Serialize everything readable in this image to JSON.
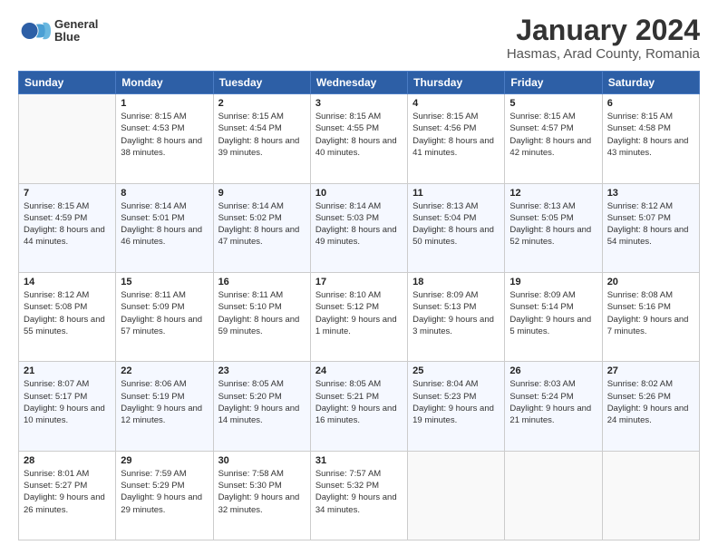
{
  "logo": {
    "line1": "General",
    "line2": "Blue"
  },
  "title": "January 2024",
  "subtitle": "Hasmas, Arad County, Romania",
  "days_of_week": [
    "Sunday",
    "Monday",
    "Tuesday",
    "Wednesday",
    "Thursday",
    "Friday",
    "Saturday"
  ],
  "weeks": [
    [
      {
        "day": "",
        "sunrise": "",
        "sunset": "",
        "daylight": ""
      },
      {
        "day": "1",
        "sunrise": "Sunrise: 8:15 AM",
        "sunset": "Sunset: 4:53 PM",
        "daylight": "Daylight: 8 hours and 38 minutes."
      },
      {
        "day": "2",
        "sunrise": "Sunrise: 8:15 AM",
        "sunset": "Sunset: 4:54 PM",
        "daylight": "Daylight: 8 hours and 39 minutes."
      },
      {
        "day": "3",
        "sunrise": "Sunrise: 8:15 AM",
        "sunset": "Sunset: 4:55 PM",
        "daylight": "Daylight: 8 hours and 40 minutes."
      },
      {
        "day": "4",
        "sunrise": "Sunrise: 8:15 AM",
        "sunset": "Sunset: 4:56 PM",
        "daylight": "Daylight: 8 hours and 41 minutes."
      },
      {
        "day": "5",
        "sunrise": "Sunrise: 8:15 AM",
        "sunset": "Sunset: 4:57 PM",
        "daylight": "Daylight: 8 hours and 42 minutes."
      },
      {
        "day": "6",
        "sunrise": "Sunrise: 8:15 AM",
        "sunset": "Sunset: 4:58 PM",
        "daylight": "Daylight: 8 hours and 43 minutes."
      }
    ],
    [
      {
        "day": "7",
        "sunrise": "Sunrise: 8:15 AM",
        "sunset": "Sunset: 4:59 PM",
        "daylight": "Daylight: 8 hours and 44 minutes."
      },
      {
        "day": "8",
        "sunrise": "Sunrise: 8:14 AM",
        "sunset": "Sunset: 5:01 PM",
        "daylight": "Daylight: 8 hours and 46 minutes."
      },
      {
        "day": "9",
        "sunrise": "Sunrise: 8:14 AM",
        "sunset": "Sunset: 5:02 PM",
        "daylight": "Daylight: 8 hours and 47 minutes."
      },
      {
        "day": "10",
        "sunrise": "Sunrise: 8:14 AM",
        "sunset": "Sunset: 5:03 PM",
        "daylight": "Daylight: 8 hours and 49 minutes."
      },
      {
        "day": "11",
        "sunrise": "Sunrise: 8:13 AM",
        "sunset": "Sunset: 5:04 PM",
        "daylight": "Daylight: 8 hours and 50 minutes."
      },
      {
        "day": "12",
        "sunrise": "Sunrise: 8:13 AM",
        "sunset": "Sunset: 5:05 PM",
        "daylight": "Daylight: 8 hours and 52 minutes."
      },
      {
        "day": "13",
        "sunrise": "Sunrise: 8:12 AM",
        "sunset": "Sunset: 5:07 PM",
        "daylight": "Daylight: 8 hours and 54 minutes."
      }
    ],
    [
      {
        "day": "14",
        "sunrise": "Sunrise: 8:12 AM",
        "sunset": "Sunset: 5:08 PM",
        "daylight": "Daylight: 8 hours and 55 minutes."
      },
      {
        "day": "15",
        "sunrise": "Sunrise: 8:11 AM",
        "sunset": "Sunset: 5:09 PM",
        "daylight": "Daylight: 8 hours and 57 minutes."
      },
      {
        "day": "16",
        "sunrise": "Sunrise: 8:11 AM",
        "sunset": "Sunset: 5:10 PM",
        "daylight": "Daylight: 8 hours and 59 minutes."
      },
      {
        "day": "17",
        "sunrise": "Sunrise: 8:10 AM",
        "sunset": "Sunset: 5:12 PM",
        "daylight": "Daylight: 9 hours and 1 minute."
      },
      {
        "day": "18",
        "sunrise": "Sunrise: 8:09 AM",
        "sunset": "Sunset: 5:13 PM",
        "daylight": "Daylight: 9 hours and 3 minutes."
      },
      {
        "day": "19",
        "sunrise": "Sunrise: 8:09 AM",
        "sunset": "Sunset: 5:14 PM",
        "daylight": "Daylight: 9 hours and 5 minutes."
      },
      {
        "day": "20",
        "sunrise": "Sunrise: 8:08 AM",
        "sunset": "Sunset: 5:16 PM",
        "daylight": "Daylight: 9 hours and 7 minutes."
      }
    ],
    [
      {
        "day": "21",
        "sunrise": "Sunrise: 8:07 AM",
        "sunset": "Sunset: 5:17 PM",
        "daylight": "Daylight: 9 hours and 10 minutes."
      },
      {
        "day": "22",
        "sunrise": "Sunrise: 8:06 AM",
        "sunset": "Sunset: 5:19 PM",
        "daylight": "Daylight: 9 hours and 12 minutes."
      },
      {
        "day": "23",
        "sunrise": "Sunrise: 8:05 AM",
        "sunset": "Sunset: 5:20 PM",
        "daylight": "Daylight: 9 hours and 14 minutes."
      },
      {
        "day": "24",
        "sunrise": "Sunrise: 8:05 AM",
        "sunset": "Sunset: 5:21 PM",
        "daylight": "Daylight: 9 hours and 16 minutes."
      },
      {
        "day": "25",
        "sunrise": "Sunrise: 8:04 AM",
        "sunset": "Sunset: 5:23 PM",
        "daylight": "Daylight: 9 hours and 19 minutes."
      },
      {
        "day": "26",
        "sunrise": "Sunrise: 8:03 AM",
        "sunset": "Sunset: 5:24 PM",
        "daylight": "Daylight: 9 hours and 21 minutes."
      },
      {
        "day": "27",
        "sunrise": "Sunrise: 8:02 AM",
        "sunset": "Sunset: 5:26 PM",
        "daylight": "Daylight: 9 hours and 24 minutes."
      }
    ],
    [
      {
        "day": "28",
        "sunrise": "Sunrise: 8:01 AM",
        "sunset": "Sunset: 5:27 PM",
        "daylight": "Daylight: 9 hours and 26 minutes."
      },
      {
        "day": "29",
        "sunrise": "Sunrise: 7:59 AM",
        "sunset": "Sunset: 5:29 PM",
        "daylight": "Daylight: 9 hours and 29 minutes."
      },
      {
        "day": "30",
        "sunrise": "Sunrise: 7:58 AM",
        "sunset": "Sunset: 5:30 PM",
        "daylight": "Daylight: 9 hours and 32 minutes."
      },
      {
        "day": "31",
        "sunrise": "Sunrise: 7:57 AM",
        "sunset": "Sunset: 5:32 PM",
        "daylight": "Daylight: 9 hours and 34 minutes."
      },
      {
        "day": "",
        "sunrise": "",
        "sunset": "",
        "daylight": ""
      },
      {
        "day": "",
        "sunrise": "",
        "sunset": "",
        "daylight": ""
      },
      {
        "day": "",
        "sunrise": "",
        "sunset": "",
        "daylight": ""
      }
    ]
  ]
}
